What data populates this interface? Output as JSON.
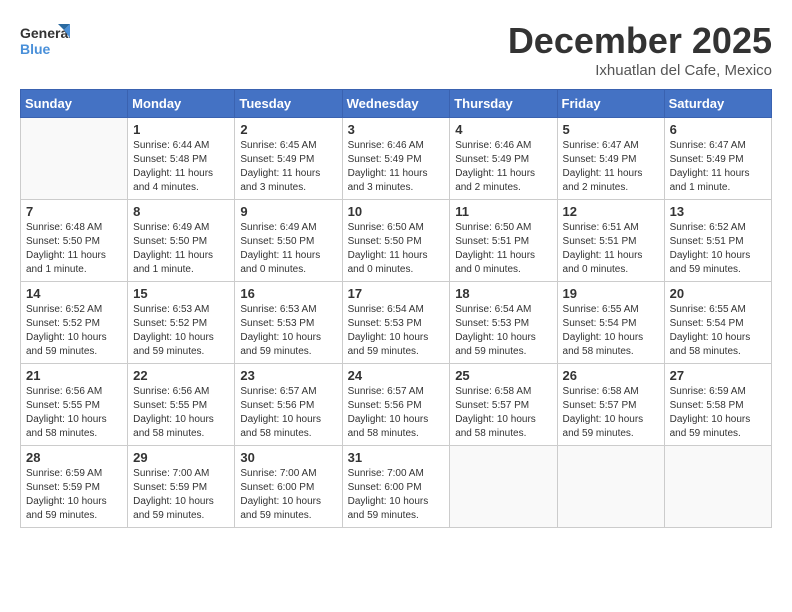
{
  "logo": {
    "text_general": "General",
    "text_blue": "Blue"
  },
  "title": "December 2025",
  "subtitle": "Ixhuatlan del Cafe, Mexico",
  "headers": [
    "Sunday",
    "Monday",
    "Tuesday",
    "Wednesday",
    "Thursday",
    "Friday",
    "Saturday"
  ],
  "weeks": [
    [
      {
        "day": "",
        "info": ""
      },
      {
        "day": "1",
        "info": "Sunrise: 6:44 AM\nSunset: 5:48 PM\nDaylight: 11 hours\nand 4 minutes."
      },
      {
        "day": "2",
        "info": "Sunrise: 6:45 AM\nSunset: 5:49 PM\nDaylight: 11 hours\nand 3 minutes."
      },
      {
        "day": "3",
        "info": "Sunrise: 6:46 AM\nSunset: 5:49 PM\nDaylight: 11 hours\nand 3 minutes."
      },
      {
        "day": "4",
        "info": "Sunrise: 6:46 AM\nSunset: 5:49 PM\nDaylight: 11 hours\nand 2 minutes."
      },
      {
        "day": "5",
        "info": "Sunrise: 6:47 AM\nSunset: 5:49 PM\nDaylight: 11 hours\nand 2 minutes."
      },
      {
        "day": "6",
        "info": "Sunrise: 6:47 AM\nSunset: 5:49 PM\nDaylight: 11 hours\nand 1 minute."
      }
    ],
    [
      {
        "day": "7",
        "info": "Sunrise: 6:48 AM\nSunset: 5:50 PM\nDaylight: 11 hours\nand 1 minute."
      },
      {
        "day": "8",
        "info": "Sunrise: 6:49 AM\nSunset: 5:50 PM\nDaylight: 11 hours\nand 1 minute."
      },
      {
        "day": "9",
        "info": "Sunrise: 6:49 AM\nSunset: 5:50 PM\nDaylight: 11 hours\nand 0 minutes."
      },
      {
        "day": "10",
        "info": "Sunrise: 6:50 AM\nSunset: 5:50 PM\nDaylight: 11 hours\nand 0 minutes."
      },
      {
        "day": "11",
        "info": "Sunrise: 6:50 AM\nSunset: 5:51 PM\nDaylight: 11 hours\nand 0 minutes."
      },
      {
        "day": "12",
        "info": "Sunrise: 6:51 AM\nSunset: 5:51 PM\nDaylight: 11 hours\nand 0 minutes."
      },
      {
        "day": "13",
        "info": "Sunrise: 6:52 AM\nSunset: 5:51 PM\nDaylight: 10 hours\nand 59 minutes."
      }
    ],
    [
      {
        "day": "14",
        "info": "Sunrise: 6:52 AM\nSunset: 5:52 PM\nDaylight: 10 hours\nand 59 minutes."
      },
      {
        "day": "15",
        "info": "Sunrise: 6:53 AM\nSunset: 5:52 PM\nDaylight: 10 hours\nand 59 minutes."
      },
      {
        "day": "16",
        "info": "Sunrise: 6:53 AM\nSunset: 5:53 PM\nDaylight: 10 hours\nand 59 minutes."
      },
      {
        "day": "17",
        "info": "Sunrise: 6:54 AM\nSunset: 5:53 PM\nDaylight: 10 hours\nand 59 minutes."
      },
      {
        "day": "18",
        "info": "Sunrise: 6:54 AM\nSunset: 5:53 PM\nDaylight: 10 hours\nand 59 minutes."
      },
      {
        "day": "19",
        "info": "Sunrise: 6:55 AM\nSunset: 5:54 PM\nDaylight: 10 hours\nand 58 minutes."
      },
      {
        "day": "20",
        "info": "Sunrise: 6:55 AM\nSunset: 5:54 PM\nDaylight: 10 hours\nand 58 minutes."
      }
    ],
    [
      {
        "day": "21",
        "info": "Sunrise: 6:56 AM\nSunset: 5:55 PM\nDaylight: 10 hours\nand 58 minutes."
      },
      {
        "day": "22",
        "info": "Sunrise: 6:56 AM\nSunset: 5:55 PM\nDaylight: 10 hours\nand 58 minutes."
      },
      {
        "day": "23",
        "info": "Sunrise: 6:57 AM\nSunset: 5:56 PM\nDaylight: 10 hours\nand 58 minutes."
      },
      {
        "day": "24",
        "info": "Sunrise: 6:57 AM\nSunset: 5:56 PM\nDaylight: 10 hours\nand 58 minutes."
      },
      {
        "day": "25",
        "info": "Sunrise: 6:58 AM\nSunset: 5:57 PM\nDaylight: 10 hours\nand 58 minutes."
      },
      {
        "day": "26",
        "info": "Sunrise: 6:58 AM\nSunset: 5:57 PM\nDaylight: 10 hours\nand 59 minutes."
      },
      {
        "day": "27",
        "info": "Sunrise: 6:59 AM\nSunset: 5:58 PM\nDaylight: 10 hours\nand 59 minutes."
      }
    ],
    [
      {
        "day": "28",
        "info": "Sunrise: 6:59 AM\nSunset: 5:59 PM\nDaylight: 10 hours\nand 59 minutes."
      },
      {
        "day": "29",
        "info": "Sunrise: 7:00 AM\nSunset: 5:59 PM\nDaylight: 10 hours\nand 59 minutes."
      },
      {
        "day": "30",
        "info": "Sunrise: 7:00 AM\nSunset: 6:00 PM\nDaylight: 10 hours\nand 59 minutes."
      },
      {
        "day": "31",
        "info": "Sunrise: 7:00 AM\nSunset: 6:00 PM\nDaylight: 10 hours\nand 59 minutes."
      },
      {
        "day": "",
        "info": ""
      },
      {
        "day": "",
        "info": ""
      },
      {
        "day": "",
        "info": ""
      }
    ]
  ]
}
